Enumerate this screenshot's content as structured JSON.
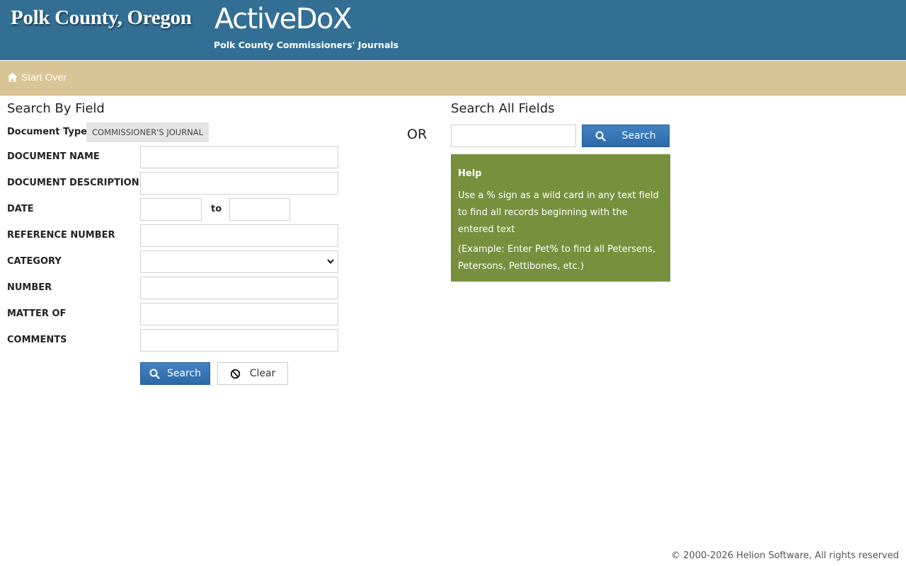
{
  "header": {
    "county": "Polk County, Oregon",
    "app_name": "ActiveDoX",
    "subtitle": "Polk County Commissioners' Journals",
    "background": "#336f94"
  },
  "nav": {
    "start_over": "Start Over",
    "icon": "home-icon",
    "background": "#d9c495"
  },
  "field_search": {
    "title": "Search By Field",
    "document_type_label": "Document Type:",
    "document_type_value": "COMMISSIONER'S JOURNAL",
    "fields": {
      "document_name": {
        "label": "DOCUMENT NAME",
        "value": ""
      },
      "document_description": {
        "label": "DOCUMENT DESCRIPTION",
        "value": ""
      },
      "date": {
        "label": "DATE",
        "from_value": "",
        "to_label": "to",
        "to_value": ""
      },
      "reference_number": {
        "label": "REFERENCE NUMBER",
        "value": ""
      },
      "category": {
        "label": "CATEGORY",
        "selected": ""
      },
      "number": {
        "label": "NUMBER",
        "value": ""
      },
      "matter_of": {
        "label": "MATTER OF",
        "value": ""
      },
      "comments": {
        "label": "COMMENTS",
        "value": ""
      }
    },
    "search_button": "Search",
    "clear_button": "Clear"
  },
  "or_text": "OR",
  "all_search": {
    "title": "Search All Fields",
    "value": "",
    "search_button": "Search"
  },
  "help": {
    "title": "Help",
    "text1": "Use a % sign as a wild card in any text field to find all records beginning with the entered text",
    "text2": "(Example: Enter Pet% to find all Petersens, Petersons, Pettibones, etc.)",
    "background": "#76903e"
  },
  "footer": {
    "copyright": "© 2000-2026 Helion Software, All rights reserved"
  },
  "colors": {
    "primary_button": "#2f6dad"
  }
}
